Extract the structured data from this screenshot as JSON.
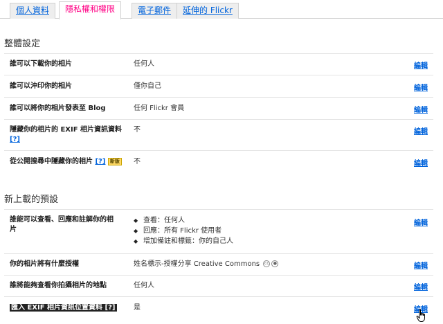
{
  "tabs": [
    {
      "label": "個人資料",
      "active": false
    },
    {
      "label": "隱私權和權限",
      "active": true
    },
    {
      "label": "電子郵件",
      "active": false
    },
    {
      "label": "延伸的 Flickr",
      "active": false
    }
  ],
  "sections": {
    "global": {
      "title": "整體設定"
    },
    "uploads": {
      "title": "新上載的預設"
    }
  },
  "rows": {
    "download": {
      "label": "誰可以下載你的相片",
      "value": "任何人"
    },
    "print": {
      "label": "誰可以沖印你的相片",
      "value": "僅你自己"
    },
    "blog": {
      "label": "誰可以將你的相片發表至 Blog",
      "value": "任何 Flickr 會員"
    },
    "exif": {
      "label_line1": "隱藏你的相片的 EXIF 相片資訊資料",
      "help": "[?]",
      "value": "不"
    },
    "search": {
      "label": "從公開搜尋中隱藏你的相片",
      "help": "[?]",
      "badge": "新版",
      "value": "不"
    },
    "view": {
      "label_line1": "誰能可以查看、回應和註解你的相",
      "label_line2": "片",
      "bullets": [
        "查看：任何人",
        "回應：所有 Flickr 使用者",
        "增加備註和標籤：你的自己人"
      ]
    },
    "license": {
      "label": "你的相片將有什麼授權",
      "value": "姓名標示-授權分享 Creative Commons"
    },
    "location": {
      "label": "誰將能夠查看你拍攝相片的地點",
      "value": "任何人"
    },
    "exif_location": {
      "label": "匯入 EXIF 相片資訊位置資料",
      "help": "[?]",
      "value": "是"
    }
  },
  "edit_label": "編輯",
  "icons": {
    "cc": "cc-icon",
    "by": "attribution-icon",
    "cursor": "hand-pointer-icon"
  }
}
